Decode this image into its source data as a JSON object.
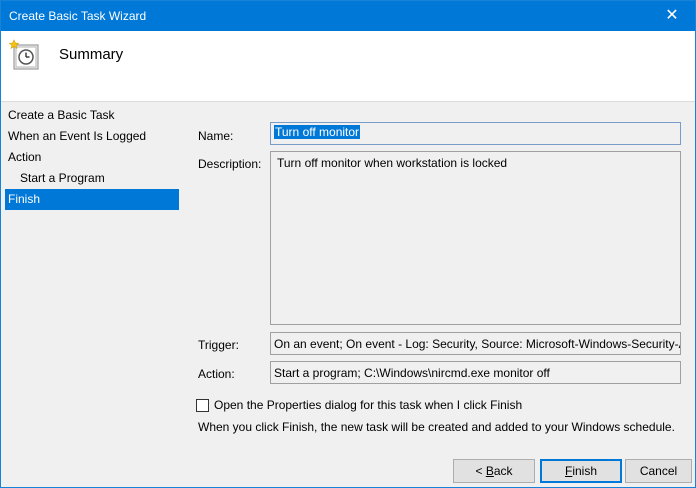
{
  "window": {
    "title": "Create Basic Task Wizard",
    "close_glyph": "✕"
  },
  "header": {
    "title": "Summary",
    "icon": "scheduled-task-clock-icon"
  },
  "nav": {
    "items": [
      {
        "label": "Create a Basic Task"
      },
      {
        "label": "When an Event Is Logged"
      },
      {
        "label": "Action"
      },
      {
        "label": "Start a Program"
      },
      {
        "label": "Finish",
        "selected": true
      }
    ]
  },
  "form": {
    "name_label": "Name:",
    "name_value": "Turn off monitor",
    "description_label": "Description:",
    "description_value": "Turn off monitor when workstation is locked",
    "trigger_label": "Trigger:",
    "trigger_value": "On an event; On event - Log: Security, Source: Microsoft-Windows-Security-Auditing",
    "action_label": "Action:",
    "action_value": "Start a program; C:\\Windows\\nircmd.exe monitor off"
  },
  "options": {
    "open_properties_label": "Open the Properties dialog for this task when I click Finish",
    "open_properties_checked": false,
    "note": "When you click Finish, the new task will be created and added to your Windows schedule."
  },
  "buttons": {
    "back_prefix": "< ",
    "back_key": "B",
    "back_rest": "ack",
    "finish_key": "F",
    "finish_rest": "inish",
    "cancel": "Cancel"
  },
  "colors": {
    "accent": "#0078d7",
    "window_bg": "#f0f0f0"
  }
}
